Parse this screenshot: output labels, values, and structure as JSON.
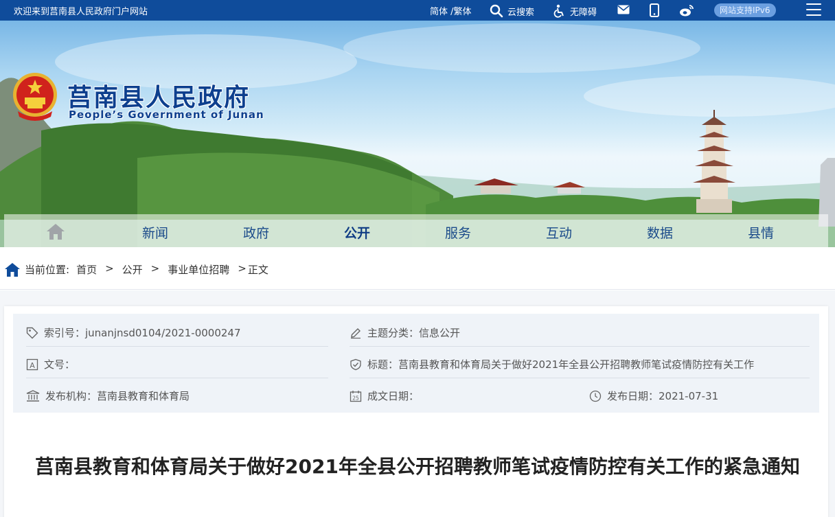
{
  "topbar": {
    "welcome": "欢迎来到莒南县人民政府门户网站",
    "lang": "简体 /繁体",
    "search": "云搜索",
    "accessibility": "无障碍",
    "ipv6": "网站支持IPv6"
  },
  "banner": {
    "title": "莒南县人民政府",
    "subtitle": "People’s Government of Junan"
  },
  "nav": {
    "items": [
      "新闻",
      "政府",
      "公开",
      "服务",
      "互动",
      "数据",
      "县情"
    ],
    "active": "公开"
  },
  "breadcrumb": {
    "label": "当前位置:",
    "items": [
      "首页",
      "公开",
      "事业单位招聘"
    ],
    "current": "正文"
  },
  "info": {
    "index_no": "索引号：junanjnsd0104/2021-0000247",
    "category": "主题分类：信息公开",
    "doc_no": "文号：",
    "subject": "标题：莒南县教育和体育局关于做好2021年全县公开招聘教师笔试疫情防控有关工作",
    "publisher": "发布机构：莒南县教育和体育局",
    "created": "成文日期：",
    "published": "发布日期：2021-07-31"
  },
  "article": {
    "title": "莒南县教育和体育局关于做好2021年全县公开招聘教师笔试疫情防控有关工作的紧急通知"
  },
  "colors": {
    "topbar": "#0f4c9b",
    "brand_blue": "#0d3f8e",
    "info_bg": "#eff3f8"
  }
}
